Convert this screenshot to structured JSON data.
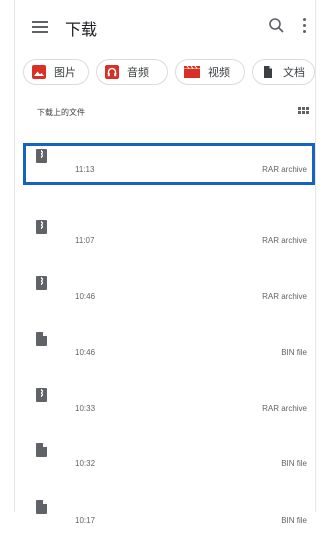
{
  "appbar": {
    "title": "下载",
    "icons": [
      "menu-icon",
      "search-icon",
      "more-vert-icon"
    ]
  },
  "chips": [
    {
      "label": "图片",
      "icon": "image-icon",
      "color": "#d93025"
    },
    {
      "label": "音频",
      "icon": "headphones-icon",
      "color": "#d93025"
    },
    {
      "label": "视频",
      "icon": "clapperboard-icon",
      "color": "#d93025"
    },
    {
      "label": "文档",
      "icon": "document-icon",
      "color": "#3c4043"
    }
  ],
  "section": {
    "header": "下载上的文件",
    "view_toggle_icon": "grid-view-icon"
  },
  "files": [
    {
      "time": "11:13",
      "type": "RAR archive",
      "icon": "archive-icon",
      "selected": true
    },
    {
      "time": "11:07",
      "type": "RAR archive",
      "icon": "archive-icon",
      "selected": false
    },
    {
      "time": "10:46",
      "type": "RAR archive",
      "icon": "archive-icon",
      "selected": false
    },
    {
      "time": "10:46",
      "type": "BIN file",
      "icon": "file-icon",
      "selected": false
    },
    {
      "time": "10:33",
      "type": "RAR archive",
      "icon": "archive-icon",
      "selected": false
    },
    {
      "time": "10:32",
      "type": "BIN file",
      "icon": "file-icon",
      "selected": false
    },
    {
      "time": "10:17",
      "type": "BIN file",
      "icon": "file-icon",
      "selected": false
    }
  ],
  "colors": {
    "selection": "#1565c0",
    "icon_gray": "#5f6368",
    "accent_red": "#d93025"
  }
}
